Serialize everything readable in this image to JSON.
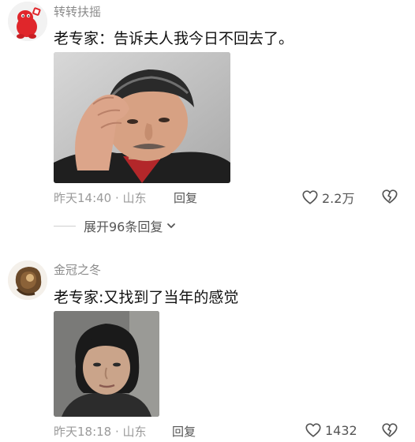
{
  "comments": [
    {
      "username": "转转扶摇",
      "text": "老专家：告诉夫人我今日不回去了。",
      "time_location": "昨天14:40 · 山东",
      "reply_label": "回复",
      "like_count": "2.2万",
      "expand_replies_label": "展开96条回复"
    },
    {
      "username": "金冠之冬",
      "text": "老专家:又找到了当年的感觉",
      "time_location": "昨天18:18 · 山东",
      "reply_label": "回复",
      "like_count": "1432"
    }
  ],
  "colors": {
    "username": "#8a8a8a",
    "meta": "#9a9a9a",
    "action": "#555555",
    "text": "#111111"
  },
  "icons": {
    "like": "heart-outline-icon",
    "dislike": "broken-heart-icon",
    "expand": "chevron-down-icon"
  }
}
